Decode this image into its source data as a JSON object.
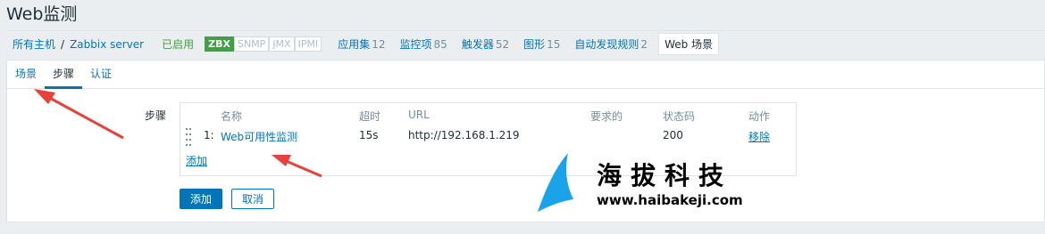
{
  "page": {
    "title": "Web监测"
  },
  "breadcrumb": {
    "all_hosts": "所有主机",
    "separator": "/",
    "host": "Zabbix server",
    "status": "已启用",
    "badges": [
      "ZBX",
      "SNMP",
      "JMX",
      "IPMI"
    ],
    "links": [
      {
        "label": "应用集",
        "count": "12"
      },
      {
        "label": "监控项",
        "count": "85"
      },
      {
        "label": "触发器",
        "count": "52"
      },
      {
        "label": "图形",
        "count": "15"
      },
      {
        "label": "自动发现规则",
        "count": "2"
      }
    ],
    "active": "Web 场景"
  },
  "tabs": [
    "场景",
    "步骤",
    "认证"
  ],
  "form": {
    "label": "步骤",
    "columns": {
      "name": "名称",
      "timeout": "超时",
      "url": "URL",
      "required": "要求的",
      "status_code": "状态码",
      "action": "动作"
    },
    "rows": [
      {
        "index": "1:",
        "name": "Web可用性监测",
        "timeout": "15s",
        "url": "http://192.168.1.219",
        "required": "",
        "status_code": "200",
        "action": "移除"
      }
    ],
    "add_link": "添加"
  },
  "buttons": {
    "add": "添加",
    "cancel": "取消"
  },
  "watermark": {
    "title": "海拔科技",
    "url": "www.haibakeji.com"
  },
  "colors": {
    "accent": "#0275b8",
    "enabled": "#429e47",
    "arrow": "#e8403a",
    "logo": "#1aa3e8"
  }
}
